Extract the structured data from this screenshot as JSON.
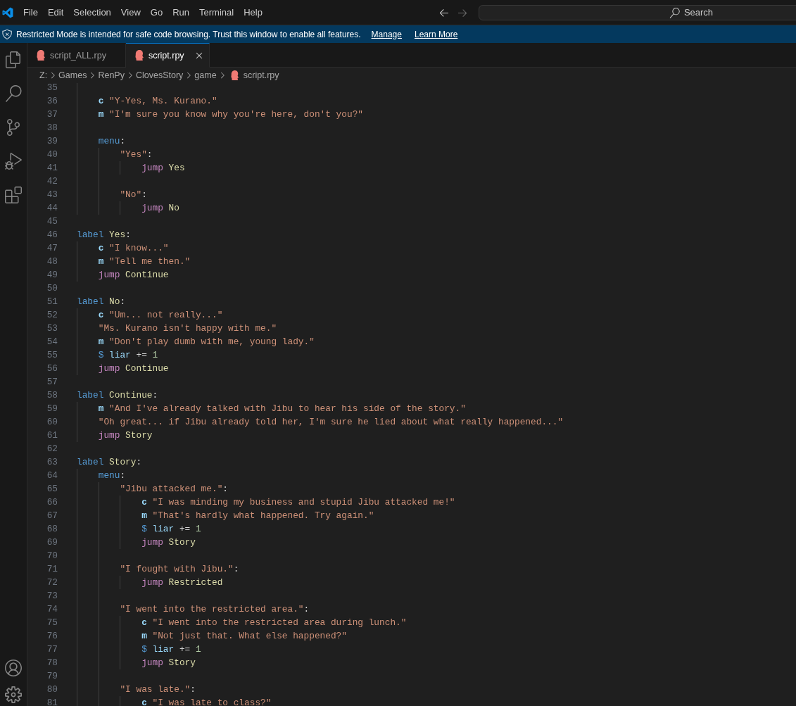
{
  "title_bar": {
    "menu": [
      "File",
      "Edit",
      "Selection",
      "View",
      "Go",
      "Run",
      "Terminal",
      "Help"
    ],
    "navigation": {
      "back": {
        "disabled": false
      },
      "forward": {
        "disabled": true
      }
    },
    "search": {
      "placeholder": "Search"
    }
  },
  "banner": {
    "message": "Restricted Mode is intended for safe code browsing. Trust this window to enable all features.",
    "links": [
      "Manage",
      "Learn More"
    ]
  },
  "tabs": [
    {
      "label": "script_ALL.rpy",
      "selected": false
    },
    {
      "label": "script.rpy",
      "selected": true
    }
  ],
  "breadcrumbs": [
    "Z:",
    "Games",
    "RenPy",
    "ClovesStory",
    "game",
    "script.rpy"
  ],
  "editor": {
    "lines": [
      {
        "children": [
          {
            "number": "35"
          },
          {
            "number": "36",
            "words": [
              [
                {
                  "kind": "speaker",
                  "text": "c"
                }
              ],
              [
                {
                  "kind": "string",
                  "text": "\"Y-Yes, Ms. Kurano.\""
                }
              ]
            ]
          },
          {
            "number": "37",
            "words": [
              [
                {
                  "kind": "speaker",
                  "text": "m"
                }
              ],
              [
                {
                  "kind": "string",
                  "text": "\"I'm sure you know why you're here, don't you?\""
                }
              ]
            ]
          },
          {
            "number": "38"
          },
          {
            "number": "39",
            "words": [
              [
                {
                  "kind": "keyword",
                  "text": "menu"
                },
                {
                  "kind": "punctuation",
                  "text": ":"
                }
              ]
            ],
            "children": [
              {
                "number": "40",
                "words": [
                  [
                    {
                      "kind": "string",
                      "text": "\"Yes\""
                    },
                    {
                      "kind": "punctuation",
                      "text": ":"
                    }
                  ]
                ],
                "children": [
                  {
                    "number": "41",
                    "words": [
                      [
                        {
                          "kind": "flow",
                          "text": "jump"
                        }
                      ],
                      [
                        {
                          "kind": "name",
                          "text": "Yes"
                        }
                      ]
                    ]
                  }
                ]
              },
              {
                "number": "42"
              },
              {
                "number": "43",
                "words": [
                  [
                    {
                      "kind": "string",
                      "text": "\"No\""
                    },
                    {
                      "kind": "punctuation",
                      "text": ":"
                    }
                  ]
                ],
                "children": [
                  {
                    "number": "44",
                    "words": [
                      [
                        {
                          "kind": "flow",
                          "text": "jump"
                        }
                      ],
                      [
                        {
                          "kind": "name",
                          "text": "No"
                        }
                      ]
                    ]
                  }
                ]
              }
            ]
          }
        ]
      },
      {
        "number": "45"
      },
      {
        "number": "46",
        "words": [
          [
            {
              "kind": "keyword",
              "text": "label"
            }
          ],
          [
            {
              "kind": "name",
              "text": "Yes"
            },
            {
              "kind": "punctuation",
              "text": ":"
            }
          ]
        ],
        "children": [
          {
            "number": "47",
            "words": [
              [
                {
                  "kind": "speaker",
                  "text": "c"
                }
              ],
              [
                {
                  "kind": "string",
                  "text": "\"I know...\""
                }
              ]
            ]
          },
          {
            "number": "48",
            "words": [
              [
                {
                  "kind": "speaker",
                  "text": "m"
                }
              ],
              [
                {
                  "kind": "string",
                  "text": "\"Tell me then.\""
                }
              ]
            ]
          },
          {
            "number": "49",
            "words": [
              [
                {
                  "kind": "flow",
                  "text": "jump"
                }
              ],
              [
                {
                  "kind": "name",
                  "text": "Continue"
                }
              ]
            ]
          }
        ]
      },
      {
        "number": "50"
      },
      {
        "number": "51",
        "words": [
          [
            {
              "kind": "keyword",
              "text": "label"
            }
          ],
          [
            {
              "kind": "name",
              "text": "No"
            },
            {
              "kind": "punctuation",
              "text": ":"
            }
          ]
        ],
        "children": [
          {
            "number": "52",
            "words": [
              [
                {
                  "kind": "speaker",
                  "text": "c"
                }
              ],
              [
                {
                  "kind": "string",
                  "text": "\"Um... not really...\""
                }
              ]
            ]
          },
          {
            "number": "53",
            "words": [
              [
                {
                  "kind": "string",
                  "text": "\"Ms. Kurano isn't happy with me.\""
                }
              ]
            ]
          },
          {
            "number": "54",
            "words": [
              [
                {
                  "kind": "speaker",
                  "text": "m"
                }
              ],
              [
                {
                  "kind": "string",
                  "text": "\"Don't play dumb with me, young lady.\""
                }
              ]
            ]
          },
          {
            "number": "55",
            "words": [
              [
                {
                  "kind": "keyword",
                  "text": "$"
                }
              ],
              [
                {
                  "kind": "variable",
                  "text": "liar"
                }
              ],
              [
                {
                  "kind": "operator",
                  "text": "+="
                }
              ],
              [
                {
                  "kind": "number",
                  "text": "1"
                }
              ]
            ]
          },
          {
            "number": "56",
            "words": [
              [
                {
                  "kind": "flow",
                  "text": "jump"
                }
              ],
              [
                {
                  "kind": "name",
                  "text": "Continue"
                }
              ]
            ]
          }
        ]
      },
      {
        "number": "57"
      },
      {
        "number": "58",
        "words": [
          [
            {
              "kind": "keyword",
              "text": "label"
            }
          ],
          [
            {
              "kind": "name",
              "text": "Continue"
            },
            {
              "kind": "punctuation",
              "text": ":"
            }
          ]
        ],
        "children": [
          {
            "number": "59",
            "words": [
              [
                {
                  "kind": "speaker",
                  "text": "m"
                }
              ],
              [
                {
                  "kind": "string",
                  "text": "\"And I've already talked with Jibu to hear his side of the story.\""
                }
              ]
            ]
          },
          {
            "number": "60",
            "words": [
              [
                {
                  "kind": "string",
                  "text": "\"Oh great... if Jibu already told her, I'm sure he lied about what really happened...\""
                }
              ]
            ]
          },
          {
            "number": "61",
            "words": [
              [
                {
                  "kind": "flow",
                  "text": "jump"
                }
              ],
              [
                {
                  "kind": "name",
                  "text": "Story"
                }
              ]
            ]
          }
        ]
      },
      {
        "number": "62"
      },
      {
        "number": "63",
        "words": [
          [
            {
              "kind": "keyword",
              "text": "label"
            }
          ],
          [
            {
              "kind": "name",
              "text": "Story"
            },
            {
              "kind": "punctuation",
              "text": ":"
            }
          ]
        ],
        "children": [
          {
            "number": "64",
            "words": [
              [
                {
                  "kind": "keyword",
                  "text": "menu"
                },
                {
                  "kind": "punctuation",
                  "text": ":"
                }
              ]
            ],
            "children": [
              {
                "number": "65",
                "words": [
                  [
                    {
                      "kind": "string",
                      "text": "\"Jibu attacked me.\""
                    },
                    {
                      "kind": "punctuation",
                      "text": ":"
                    }
                  ]
                ],
                "children": [
                  {
                    "number": "66",
                    "words": [
                      [
                        {
                          "kind": "speaker",
                          "text": "c"
                        }
                      ],
                      [
                        {
                          "kind": "string",
                          "text": "\"I was minding my business and stupid Jibu attacked me!\""
                        }
                      ]
                    ]
                  },
                  {
                    "number": "67",
                    "words": [
                      [
                        {
                          "kind": "speaker",
                          "text": "m"
                        }
                      ],
                      [
                        {
                          "kind": "string",
                          "text": "\"That's hardly what happened. Try again.\""
                        }
                      ]
                    ]
                  },
                  {
                    "number": "68",
                    "words": [
                      [
                        {
                          "kind": "keyword",
                          "text": "$"
                        }
                      ],
                      [
                        {
                          "kind": "variable",
                          "text": "liar"
                        }
                      ],
                      [
                        {
                          "kind": "operator",
                          "text": "+="
                        }
                      ],
                      [
                        {
                          "kind": "number",
                          "text": "1"
                        }
                      ]
                    ]
                  },
                  {
                    "number": "69",
                    "words": [
                      [
                        {
                          "kind": "flow",
                          "text": "jump"
                        }
                      ],
                      [
                        {
                          "kind": "name",
                          "text": "Story"
                        }
                      ]
                    ]
                  }
                ]
              },
              {
                "number": "70"
              },
              {
                "number": "71",
                "words": [
                  [
                    {
                      "kind": "string",
                      "text": "\"I fought with Jibu.\""
                    },
                    {
                      "kind": "punctuation",
                      "text": ":"
                    }
                  ]
                ],
                "children": [
                  {
                    "number": "72",
                    "words": [
                      [
                        {
                          "kind": "flow",
                          "text": "jump"
                        }
                      ],
                      [
                        {
                          "kind": "name",
                          "text": "Restricted"
                        }
                      ]
                    ]
                  }
                ]
              },
              {
                "number": "73"
              },
              {
                "number": "74",
                "words": [
                  [
                    {
                      "kind": "string",
                      "text": "\"I went into the restricted area.\""
                    },
                    {
                      "kind": "punctuation",
                      "text": ":"
                    }
                  ]
                ],
                "children": [
                  {
                    "number": "75",
                    "words": [
                      [
                        {
                          "kind": "speaker",
                          "text": "c"
                        }
                      ],
                      [
                        {
                          "kind": "string",
                          "text": "\"I went into the restricted area during lunch.\""
                        }
                      ]
                    ]
                  },
                  {
                    "number": "76",
                    "words": [
                      [
                        {
                          "kind": "speaker",
                          "text": "m"
                        }
                      ],
                      [
                        {
                          "kind": "string",
                          "text": "\"Not just that. What else happened?\""
                        }
                      ]
                    ]
                  },
                  {
                    "number": "77",
                    "words": [
                      [
                        {
                          "kind": "keyword",
                          "text": "$"
                        }
                      ],
                      [
                        {
                          "kind": "variable",
                          "text": "liar"
                        }
                      ],
                      [
                        {
                          "kind": "operator",
                          "text": "+="
                        }
                      ],
                      [
                        {
                          "kind": "number",
                          "text": "1"
                        }
                      ]
                    ]
                  },
                  {
                    "number": "78",
                    "words": [
                      [
                        {
                          "kind": "flow",
                          "text": "jump"
                        }
                      ],
                      [
                        {
                          "kind": "name",
                          "text": "Story"
                        }
                      ]
                    ]
                  }
                ]
              },
              {
                "number": "79"
              },
              {
                "number": "80",
                "words": [
                  [
                    {
                      "kind": "string",
                      "text": "\"I was late.\""
                    },
                    {
                      "kind": "punctuation",
                      "text": ":"
                    }
                  ]
                ],
                "children": [
                  {
                    "number": "81",
                    "words": [
                      [
                        {
                          "kind": "speaker",
                          "text": "c"
                        }
                      ],
                      [
                        {
                          "kind": "string",
                          "text": "\"I was late to class?\""
                        }
                      ]
                    ]
                  }
                ]
              }
            ]
          }
        ]
      }
    ]
  }
}
